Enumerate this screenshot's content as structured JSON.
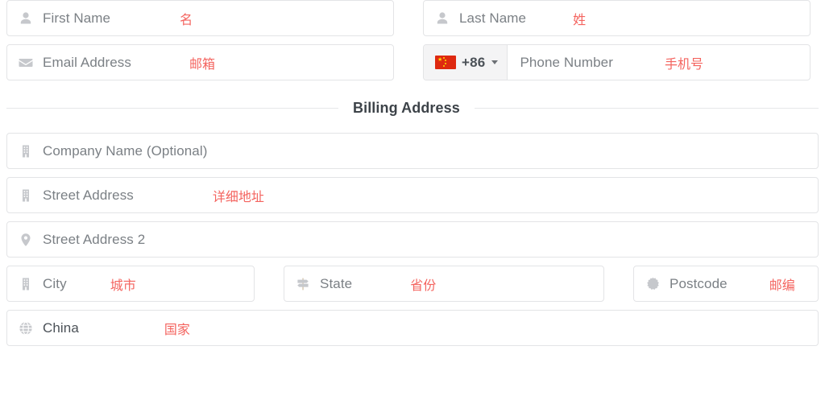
{
  "form": {
    "contact_row1": [
      {
        "icon": "person-icon",
        "placeholder": "First Name",
        "annotation": "名",
        "name": "first-name-field"
      },
      {
        "icon": "person-icon",
        "placeholder": "Last Name",
        "annotation": "姓",
        "name": "last-name-field"
      }
    ],
    "contact_row2": {
      "email": {
        "icon": "envelope-icon",
        "placeholder": "Email Address",
        "annotation": "邮箱",
        "name": "email-field"
      },
      "phone": {
        "icon": "china-flag-icon",
        "dial_code": "+86",
        "placeholder": "Phone Number",
        "annotation": "手机号",
        "name": "phone-number-field",
        "country": "China"
      }
    },
    "section_title": "Billing Address",
    "address_fields": [
      {
        "icon": "building-icon",
        "placeholder": "Company Name (Optional)",
        "annotation": "",
        "name": "company-name-field"
      },
      {
        "icon": "building-icon",
        "placeholder": "Street Address",
        "annotation": "详细地址",
        "name": "street-address-field"
      },
      {
        "icon": "map-pin-icon",
        "placeholder": "Street Address 2",
        "annotation": "",
        "name": "street-address-2-field"
      }
    ],
    "locality_row": [
      {
        "icon": "building-icon",
        "placeholder": "City",
        "annotation": "城市",
        "name": "city-field"
      },
      {
        "icon": "signpost-icon",
        "placeholder": "State",
        "annotation": "省份",
        "name": "state-field"
      },
      {
        "icon": "seal-icon",
        "placeholder": "Postcode",
        "annotation": "邮编",
        "name": "postcode-field"
      }
    ],
    "country_field": {
      "icon": "globe-icon",
      "value": "China",
      "annotation": "国家",
      "name": "country-select"
    }
  },
  "colors": {
    "annotation_red": "#f4645f",
    "placeholder_gray": "#7b8085",
    "value_dark": "#4c5258",
    "border": "#e3e4e6",
    "flag_red": "#de2910",
    "flag_yellow": "#ffde00"
  }
}
